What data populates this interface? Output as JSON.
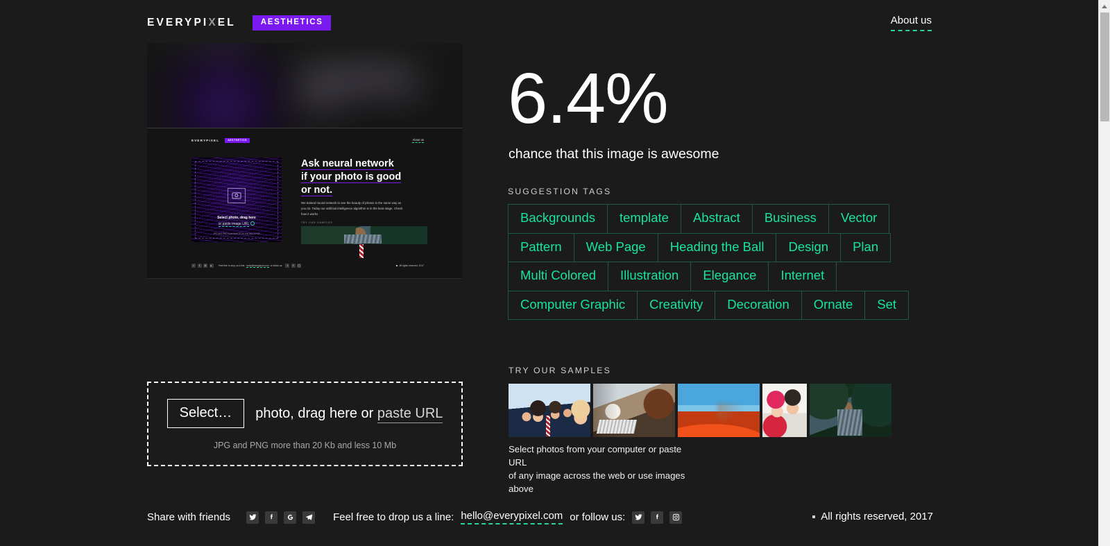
{
  "header": {
    "logo_text": "EVERYPIXEL",
    "logo_part1": "EVERYPI",
    "logo_x": "X",
    "logo_part2": "EL",
    "badge": "AESTHETICS",
    "about_label": "About us"
  },
  "result": {
    "score": "6.4%",
    "caption": "chance that this image is awesome"
  },
  "tags_section": {
    "label": "SUGGESTION TAGS",
    "rows": [
      [
        "Backgrounds",
        "template",
        "Abstract",
        "Business",
        "Vector"
      ],
      [
        "Pattern",
        "Web Page",
        "Heading the Ball",
        "Design",
        "Plan"
      ],
      [
        "Multi Colored",
        "Illustration",
        "Elegance",
        "Internet"
      ],
      [
        "Computer Graphic",
        "Creativity",
        "Decoration",
        "Ornate",
        "Set"
      ]
    ]
  },
  "samples_section": {
    "label": "TRY OUR SAMPLES",
    "items": [
      {
        "name": "sample-business-team",
        "style": "ph-business",
        "orientation": "landscape"
      },
      {
        "name": "sample-office-meeting",
        "style": "ph-office",
        "orientation": "landscape"
      },
      {
        "name": "sample-desert-dune",
        "style": "ph-dune",
        "orientation": "landscape"
      },
      {
        "name": "sample-winter-couple",
        "style": "ph-couple",
        "orientation": "portrait"
      },
      {
        "name": "sample-forest-couple",
        "style": "ph-forest",
        "orientation": "landscape"
      }
    ],
    "note_line1": "Select photos from your computer or paste URL",
    "note_line2": "of any image across the web or use images above"
  },
  "dropzone": {
    "select_label": "Select…",
    "text_before": "photo, drag here or",
    "paste_url_label": "paste URL",
    "note": "JPG and PNG more than 20 Kb and less 10 Mb"
  },
  "preview": {
    "alt": "screenshot of the Everypixel Aesthetics landing page",
    "mini": {
      "logo": "EVERYPIXEL",
      "badge": "AESTHETICS",
      "about": "About us",
      "headline_line1": "Ask neural network",
      "headline_line2": "if your photo is good",
      "headline_line3": "or not.",
      "paragraph_line1": "We trained neural network to see the beauty of photos in the",
      "paragraph_line2": "same way as you do. Today our artificial intelligence algorithm",
      "paragraph_line3": "is in the beta stage. Check how it works",
      "drop_line1": "Select photo, drag here",
      "drop_line2": "or paste image URL",
      "drop_note": "JPG and PNG more than 20 Kb and less 10 Mb",
      "samples_label": "TRY OUR SAMPLES",
      "footer_text": "Feel free to drop us a line:",
      "footer_mail": "hello@everypixel.com",
      "footer_follow": "or follow us:",
      "footer_rights": "All rights reserved, 2017"
    }
  },
  "footer": {
    "share_label": "Share with friends",
    "share_icons": [
      "twitter-icon",
      "facebook-icon",
      "google-plus-icon",
      "telegram-icon"
    ],
    "drop_line": "Feel free to drop us a line:",
    "email": "hello@everypixel.com",
    "follow_label": "or follow us:",
    "follow_icons": [
      "twitter-icon",
      "facebook-icon",
      "instagram-icon"
    ],
    "rights": "All rights reserved, 2017"
  },
  "colors": {
    "background": "#1b1b1b",
    "accent_purple": "#7a19f0",
    "accent_teal": "#2ad4a0",
    "tag_text": "#17e3a0",
    "tag_border": "#1e5a4b",
    "text": "#ffffff"
  },
  "scrollbar": {
    "position": "right",
    "thumb_top_pct": 2
  }
}
